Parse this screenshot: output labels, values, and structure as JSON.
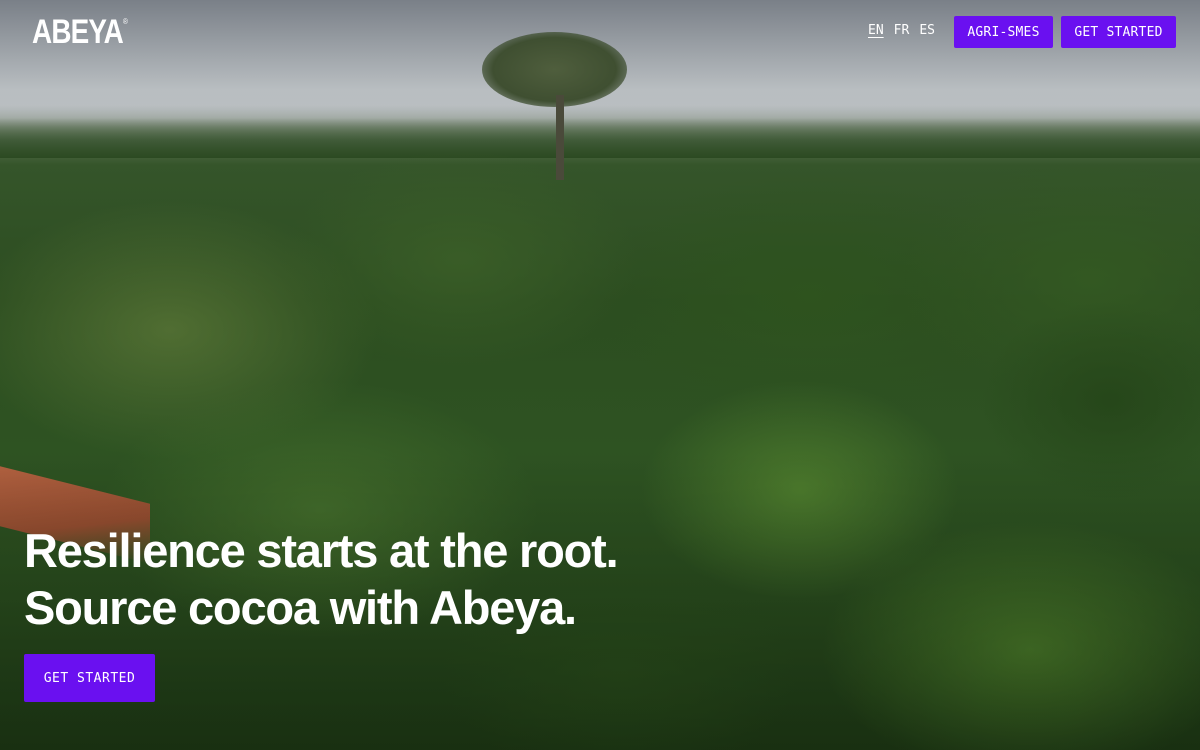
{
  "brand": {
    "logo_text": "ABEYA",
    "logo_mark": "®"
  },
  "nav": {
    "languages": [
      {
        "code": "EN",
        "active": true
      },
      {
        "code": "FR",
        "active": false
      },
      {
        "code": "ES",
        "active": false
      }
    ],
    "agri_smes_label": "AGRI-SMES",
    "get_started_label": "GET STARTED"
  },
  "hero": {
    "headline_line1": "Resilience starts at the root.",
    "headline_line2": "Source cocoa with Abeya.",
    "cta_label": "GET STARTED",
    "background_image": "aerial-rainforest-photo"
  },
  "colors": {
    "accent": "#6a10f0",
    "text": "#ffffff"
  }
}
